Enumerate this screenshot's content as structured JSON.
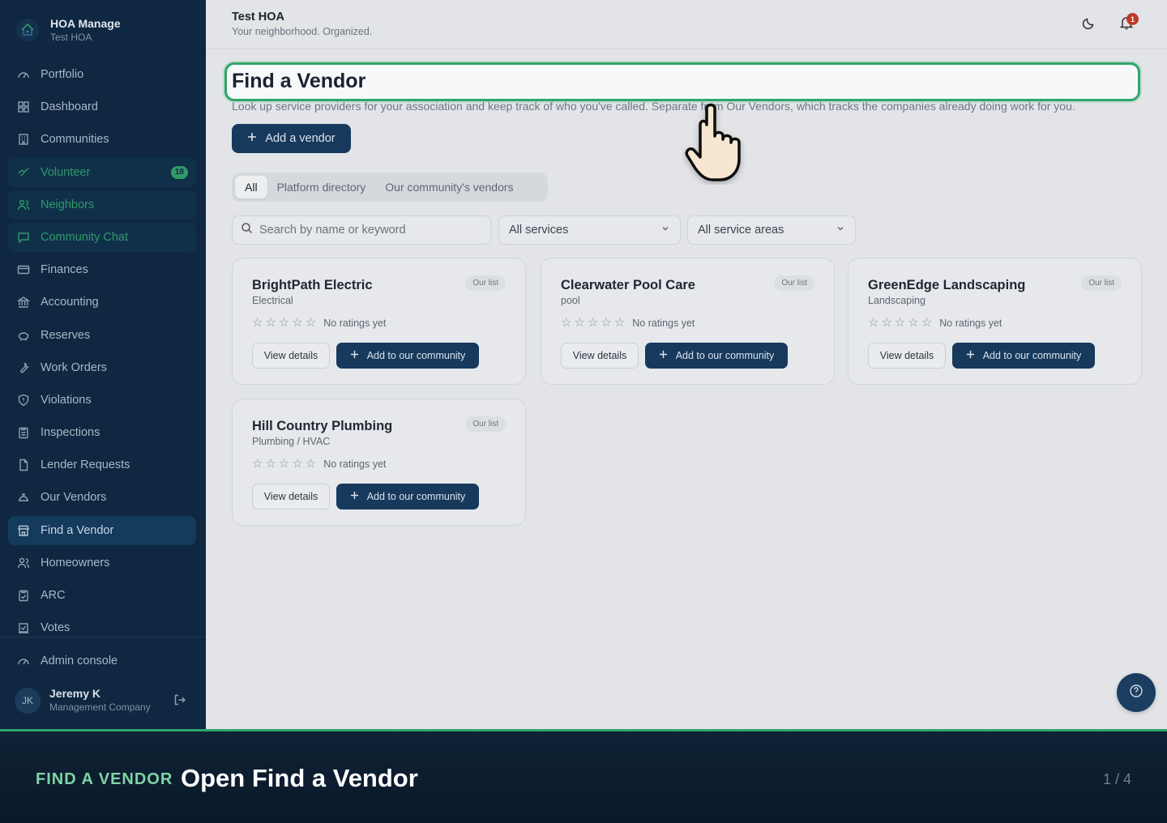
{
  "brand": {
    "name": "HOA Manage",
    "org": "Test HOA"
  },
  "nav": [
    {
      "label": "Portfolio",
      "icon": "gauge-icon"
    },
    {
      "label": "Dashboard",
      "icon": "grid-icon"
    },
    {
      "label": "Communities",
      "icon": "building-icon"
    },
    {
      "label": "Volunteer",
      "icon": "handshake-icon",
      "badge": "18"
    },
    {
      "label": "Neighbors",
      "icon": "users-icon"
    },
    {
      "label": "Community Chat",
      "icon": "chat-icon"
    },
    {
      "label": "Finances",
      "icon": "credit-card-icon"
    },
    {
      "label": "Accounting",
      "icon": "bank-icon"
    },
    {
      "label": "Reserves",
      "icon": "piggy-bank-icon"
    },
    {
      "label": "Work Orders",
      "icon": "wrench-icon"
    },
    {
      "label": "Violations",
      "icon": "shield-alert-icon"
    },
    {
      "label": "Inspections",
      "icon": "clipboard-icon"
    },
    {
      "label": "Lender Requests",
      "icon": "file-icon"
    },
    {
      "label": "Our Vendors",
      "icon": "hard-hat-icon"
    },
    {
      "label": "Find a Vendor",
      "icon": "store-icon"
    },
    {
      "label": "Homeowners",
      "icon": "users-icon"
    },
    {
      "label": "ARC",
      "icon": "clipboard-check-icon"
    },
    {
      "label": "Votes",
      "icon": "ballot-icon"
    }
  ],
  "admin": {
    "label": "Admin console",
    "icon": "gauge-icon"
  },
  "user": {
    "initials": "JK",
    "name": "Jeremy K",
    "role": "Management Company"
  },
  "topbar": {
    "title": "Test HOA",
    "subtitle": "Your neighborhood. Organized.",
    "notifications": "1"
  },
  "page": {
    "title": "Find a Vendor",
    "description": "Look up service providers for your association and keep track of who you've called. Separate from Our Vendors, which tracks the companies already doing work for you.",
    "add_button": "Add a vendor"
  },
  "tabs": [
    "All",
    "Platform directory",
    "Our community's vendors"
  ],
  "filters": {
    "search_placeholder": "Search by name or keyword",
    "services": "All services",
    "areas": "All service areas"
  },
  "vendors": [
    {
      "name": "BrightPath Electric",
      "category": "Electrical",
      "badge": "Our list",
      "rating": "No ratings yet",
      "stars": 0,
      "view": "View details",
      "add": "Add to our community"
    },
    {
      "name": "Clearwater Pool Care",
      "category": "pool",
      "badge": "Our list",
      "rating": "No ratings yet",
      "stars": 0,
      "view": "View details",
      "add": "Add to our community"
    },
    {
      "name": "GreenEdge Landscaping",
      "category": "Landscaping",
      "badge": "Our list",
      "rating": "No ratings yet",
      "stars": 0,
      "view": "View details",
      "add": "Add to our community"
    },
    {
      "name": "Hill Country Plumbing",
      "category": "Plumbing / HVAC",
      "badge": "Our list",
      "rating": "No ratings yet",
      "stars": 0,
      "view": "View details",
      "add": "Add to our community"
    }
  ],
  "caption": {
    "label": "FIND A VENDOR",
    "title": "Open Find a Vendor",
    "step": "1 / 4"
  },
  "colors": {
    "sidebar": "#0f2740",
    "accent_green": "#2fa66a",
    "primary": "#17395c",
    "badge_red": "#c0392b"
  }
}
